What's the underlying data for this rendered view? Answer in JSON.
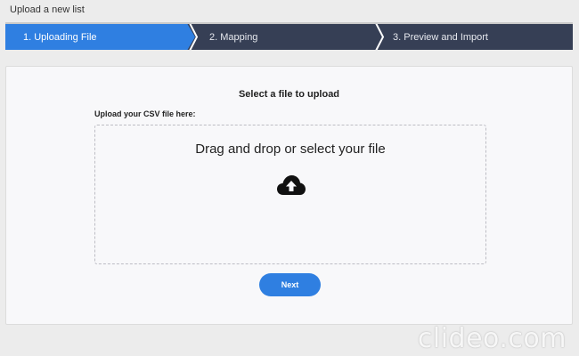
{
  "header": {
    "title": "Upload a new list"
  },
  "steps": [
    {
      "label": "1. Uploading File",
      "active": true
    },
    {
      "label": "2. Mapping",
      "active": false
    },
    {
      "label": "3. Preview and Import",
      "active": false
    }
  ],
  "card": {
    "title": "Select a file to upload",
    "upload_label": "Upload your CSV file here:",
    "dropzone_text": "Drag and drop or select your file",
    "dropzone_icon": "cloud-upload-icon"
  },
  "actions": {
    "next_label": "Next"
  },
  "watermark": {
    "text": "clideo.com"
  },
  "colors": {
    "accent": "#2f7fe1",
    "stepper_bg": "#363f55",
    "page_bg": "#ececec"
  }
}
